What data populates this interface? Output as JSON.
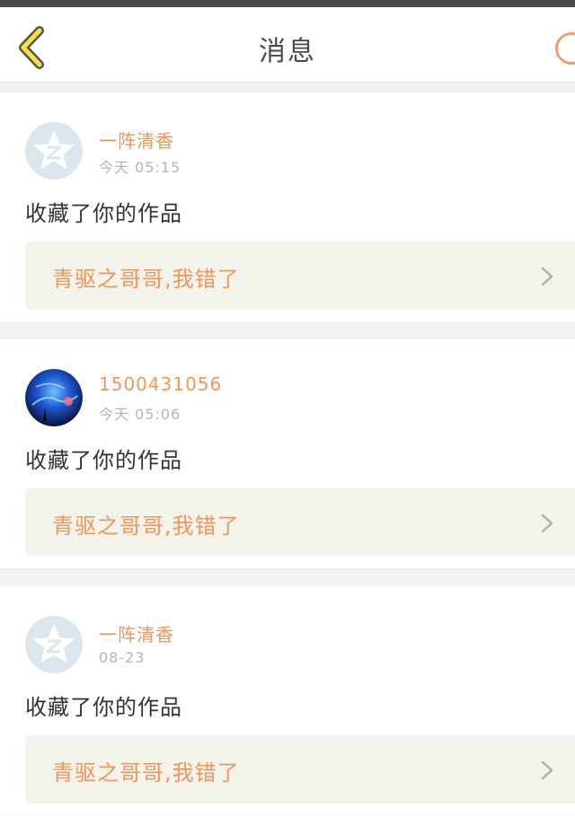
{
  "header": {
    "title": "消息"
  },
  "notifications": [
    {
      "user_name": "一阵清香",
      "time": "今天 05:15",
      "avatar_type": "default-qzone",
      "action": "收藏了你的作品",
      "work_title": "青驱之哥哥,我错了"
    },
    {
      "user_name": "1500431056",
      "time": "今天 05:06",
      "avatar_type": "photo",
      "action": "收藏了你的作品",
      "work_title": "青驱之哥哥,我错了"
    },
    {
      "user_name": "一阵清香",
      "time": "08-23",
      "avatar_type": "default-qzone",
      "action": "收藏了你的作品",
      "work_title": "青驱之哥哥,我错了"
    }
  ],
  "icons": {
    "back": "chevron-left-icon",
    "item_arrow": "chevron-right-icon",
    "default_avatar": "qzone-star-icon"
  },
  "colors": {
    "accent": "#f0965a",
    "back_icon_fill": "#f5e23a",
    "back_icon_stroke": "#555555",
    "card_box": "#f3f3ec",
    "default_avatar_bg": "#dce6ef"
  }
}
